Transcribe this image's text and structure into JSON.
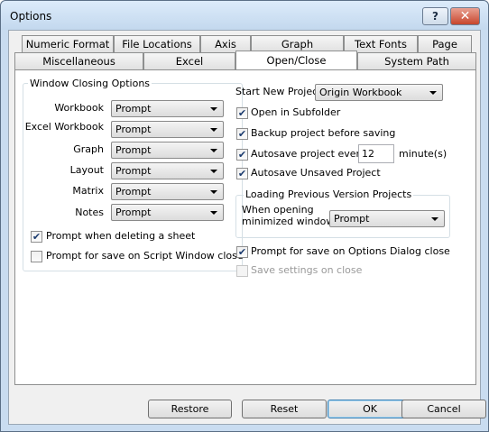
{
  "window": {
    "title": "Options",
    "help_label": "?",
    "close_label": "✕"
  },
  "tabs_row1": [
    "Numeric Format",
    "File Locations",
    "Axis",
    "Graph",
    "Text Fonts",
    "Page"
  ],
  "tabs_row2": [
    "Miscellaneous",
    "Excel",
    "Open/Close",
    "System Path"
  ],
  "active_tab": "Open/Close",
  "window_closing": {
    "title": "Window Closing Options",
    "rows": [
      {
        "label": "Workbook",
        "value": "Prompt"
      },
      {
        "label": "Excel Workbook",
        "value": "Prompt"
      },
      {
        "label": "Graph",
        "value": "Prompt"
      },
      {
        "label": "Layout",
        "value": "Prompt"
      },
      {
        "label": "Matrix",
        "value": "Prompt"
      },
      {
        "label": "Notes",
        "value": "Prompt"
      }
    ],
    "prompt_delete_sheet": {
      "label": "Prompt when deleting a sheet",
      "checked": true
    },
    "prompt_script_close": {
      "label": "Prompt for save on Script Window close",
      "checked": false
    }
  },
  "right": {
    "start_new_project_label": "Start New Project",
    "start_new_project_value": "Origin Workbook",
    "open_subfolder": {
      "label": "Open in Subfolder",
      "checked": true
    },
    "backup": {
      "label": "Backup project before saving",
      "checked": true
    },
    "autosave": {
      "label": "Autosave project every",
      "checked": true,
      "value": "12",
      "unit": "minute(s)"
    },
    "autosave_unsaved": {
      "label": "Autosave Unsaved Project",
      "checked": true
    },
    "loading_prev": {
      "title": "Loading Previous Version Projects",
      "line1": "When opening",
      "line2": "minimized windows,",
      "value": "Prompt"
    },
    "prompt_options_close": {
      "label": "Prompt for save on Options Dialog close",
      "checked": true
    },
    "save_settings_close": {
      "label": "Save settings on close",
      "checked": false,
      "disabled": true
    }
  },
  "buttons": {
    "restore": "Restore",
    "reset": "Reset",
    "ok": "OK",
    "cancel": "Cancel"
  }
}
